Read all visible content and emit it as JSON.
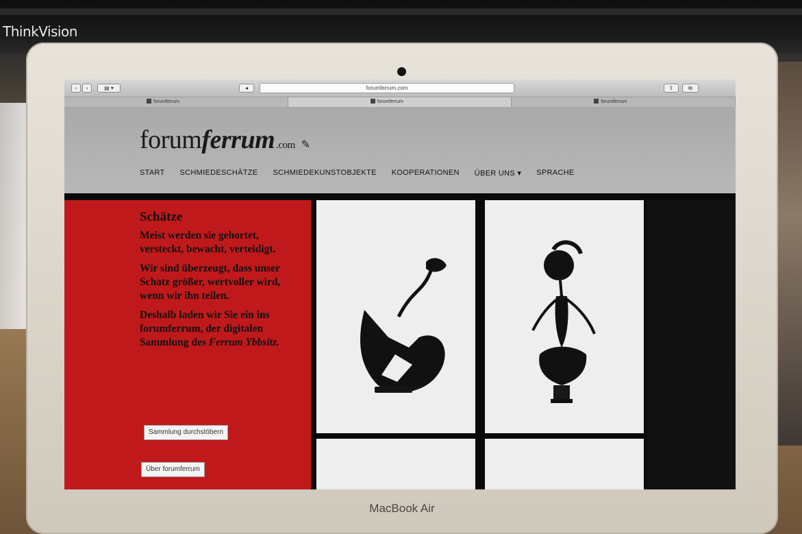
{
  "monitor": {
    "brand": "ThinkVision"
  },
  "laptop": {
    "label": "MacBook Air"
  },
  "browser": {
    "address": "forumferrum.com",
    "tabs": [
      {
        "label": "forumferrum",
        "active": false
      },
      {
        "label": "forumferrum",
        "active": true
      },
      {
        "label": "forumferrum",
        "active": false
      }
    ]
  },
  "site": {
    "logo_light": "forum",
    "logo_bold": "ferrum",
    "logo_tld": ".com",
    "nav": [
      "Start",
      "Schmiedeschätze",
      "Schmiedekunstobjekte",
      "Kooperationen",
      "Über uns ▾",
      "Sprache"
    ],
    "panel": {
      "title": "Schätze",
      "p1": "Meist werden sie gehortet, versteckt, bewacht, verteidigt.",
      "p2": "Wir sind überzeugt, dass unser Schatz größer, wertvoller wird, wenn wir ihn teilen.",
      "p3": "Deshalb laden wir Sie ein ins forumferrum, der digitalen Sammlung des",
      "p3_em": "Ferrum Ybbsitz.",
      "button1": "Sammlung durchstöbern",
      "button2": "Über forumferrum"
    },
    "colors": {
      "panel_red": "#c0191b",
      "header_gray": "#b0b0b0"
    }
  }
}
